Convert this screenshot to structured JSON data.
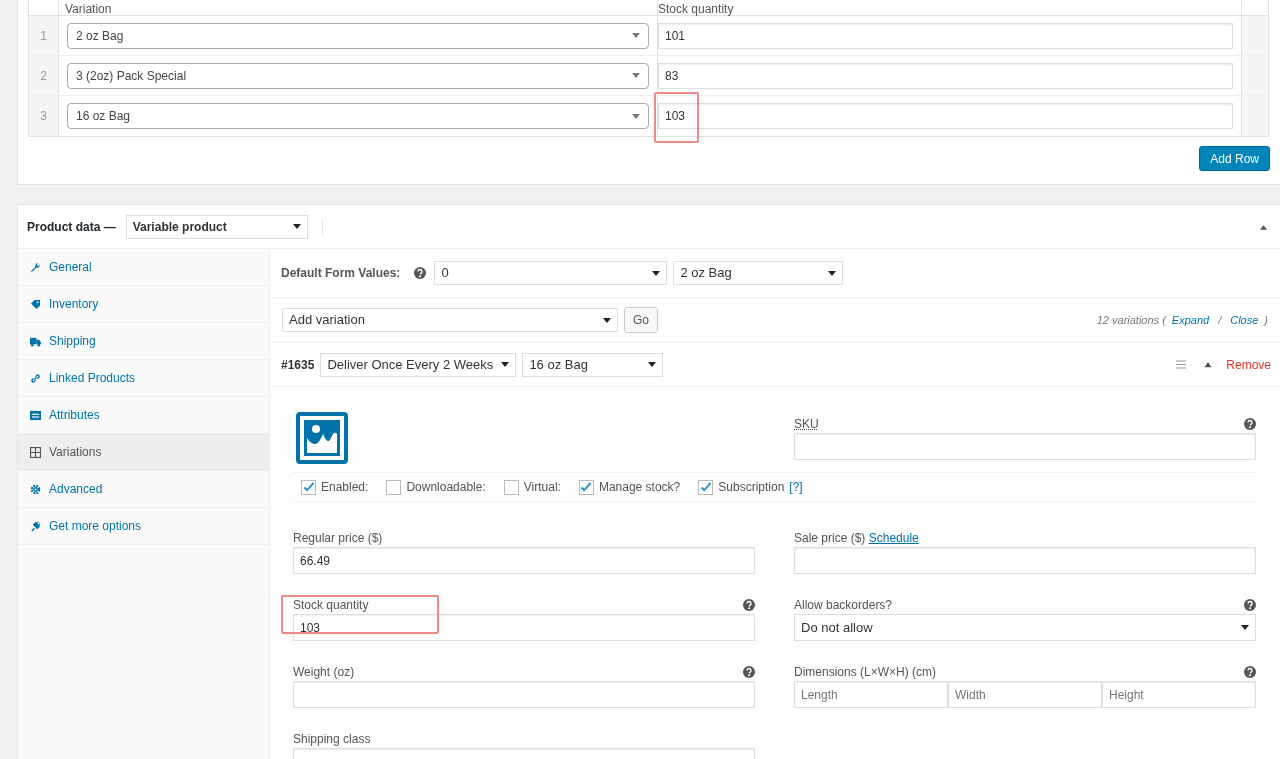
{
  "top_table": {
    "columns": [
      "Variation",
      "Stock quantity"
    ],
    "rows": [
      {
        "index": "1",
        "variation": "2 oz Bag",
        "stock": "101",
        "highlighted": false
      },
      {
        "index": "2",
        "variation": "3 (2oz) Pack Special",
        "stock": "83",
        "highlighted": false
      },
      {
        "index": "3",
        "variation": "16 oz Bag",
        "stock": "103",
        "highlighted": true
      }
    ]
  },
  "add_row_button": "Add Row",
  "product_data": {
    "label": "Product data —",
    "type": "Variable product"
  },
  "sidebar": {
    "items": [
      {
        "label": "General",
        "selected": false
      },
      {
        "label": "Inventory",
        "selected": false
      },
      {
        "label": "Shipping",
        "selected": false
      },
      {
        "label": "Linked Products",
        "selected": false
      },
      {
        "label": "Attributes",
        "selected": false
      },
      {
        "label": "Variations",
        "selected": true
      },
      {
        "label": "Advanced",
        "selected": false
      },
      {
        "label": "Get more options",
        "selected": false
      }
    ]
  },
  "default_form": {
    "label": "Default Form Values:",
    "values": [
      "0",
      "2 oz Bag"
    ]
  },
  "add_variation": {
    "value": "Add variation",
    "button": "Go"
  },
  "summary": {
    "count": "12 variations (",
    "expand": "Expand",
    "separator": "/",
    "close": "Close",
    "end": ")"
  },
  "variation": {
    "id": "#1635",
    "attributes": [
      "Deliver Once Every 2 Weeks",
      "16 oz Bag"
    ],
    "remove": "Remove",
    "sku_label": "SKU",
    "checkboxes": [
      {
        "label": "Enabled:",
        "checked": true
      },
      {
        "label": "Downloadable:",
        "checked": false
      },
      {
        "label": "Virtual:",
        "checked": false
      },
      {
        "label": "Manage stock?",
        "checked": true
      },
      {
        "label": "Subscription",
        "checked": true,
        "help": "[?]"
      }
    ],
    "fields": [
      {
        "kind": "text",
        "label": "Regular price ($)",
        "value": "66.49",
        "help": false,
        "highlighted": false
      },
      {
        "kind": "text",
        "label": "Sale price ($)",
        "link": "Schedule",
        "help": false,
        "highlighted": false
      },
      {
        "kind": "text",
        "label": "Stock quantity",
        "value": "103",
        "help": true,
        "highlighted": true
      },
      {
        "kind": "select",
        "label": "Allow backorders?",
        "value": "Do not allow",
        "help": true,
        "highlighted": false
      },
      {
        "kind": "text",
        "label": "Weight (oz)",
        "help": true,
        "highlighted": false
      },
      {
        "kind": "dimensions",
        "label": "Dimensions (L×W×H) (cm)",
        "placeholders": [
          "Length",
          "Width",
          "Height"
        ],
        "help": true,
        "highlighted": false
      },
      {
        "kind": "text",
        "label": "Shipping class",
        "help": false,
        "highlighted": false
      }
    ]
  }
}
